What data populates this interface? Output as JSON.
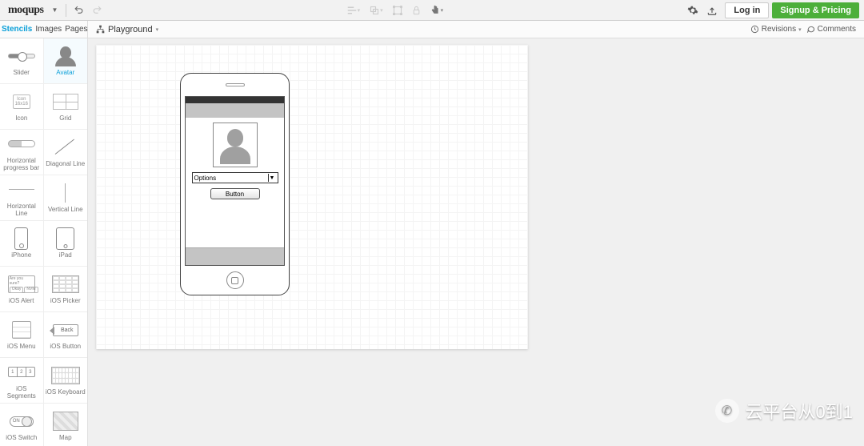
{
  "topbar": {
    "logo": "moqups",
    "login": "Log in",
    "signup": "Signup & Pricing"
  },
  "subbar": {
    "tabs": {
      "stencils": "Stencils",
      "images": "Images",
      "pages": "Pages"
    },
    "playground": "Playground",
    "revisions": "Revisions",
    "comments": "Comments"
  },
  "stencils": {
    "slider": "Slider",
    "avatar": "Avatar",
    "icon": "Icon",
    "icon_inner_top": "Icon",
    "icon_inner_sub": "16x16",
    "grid": "Grid",
    "hprogress": "Horizontal progress bar",
    "diagline": "Diagonal Line",
    "hline": "Horizontal Line",
    "vline": "Vertical Line",
    "iphone": "iPhone",
    "ipad": "iPad",
    "iosalert": "iOS Alert",
    "alert_q": "Are you sure?",
    "alert_ok": "Okay",
    "alert_nvm": "NVM",
    "iospicker": "iOS Picker",
    "iosmenu": "iOS Menu",
    "iosbutton": "iOS Button",
    "back_label": "Back",
    "iossegments": "iOS Segments",
    "ioskeyboard": "iOS Keyboard",
    "iosswitch": "iOS Switch",
    "switch_on": "ON",
    "map": "Map"
  },
  "mockup": {
    "select": "Options",
    "button": "Button"
  },
  "watermark": "云平台从0到1"
}
